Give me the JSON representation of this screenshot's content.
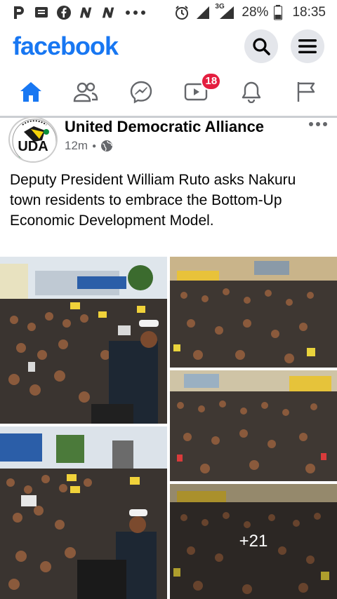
{
  "status_bar": {
    "icons_left": [
      "p-icon",
      "message-icon",
      "facebook-icon",
      "n-icon",
      "n-icon",
      "more-dots-icon"
    ],
    "network": "3G",
    "battery": "28%",
    "time": "18:35"
  },
  "header": {
    "logo": "facebook",
    "search_icon": "search-icon",
    "menu_icon": "menu-icon"
  },
  "tabs": {
    "items": [
      {
        "icon": "home-icon",
        "active": true
      },
      {
        "icon": "friends-icon"
      },
      {
        "icon": "messenger-icon"
      },
      {
        "icon": "video-icon",
        "badge": "18"
      },
      {
        "icon": "notifications-icon"
      },
      {
        "icon": "pages-flag-icon"
      }
    ],
    "accent": "#1877f2"
  },
  "post": {
    "page_name": "United Democratic Alliance",
    "avatar_text": "UDA",
    "time": "12m",
    "privacy_icon": "globe-icon",
    "text": "Deputy President William Ruto asks Nakuru town residents to embrace the Bottom-Up Economic Development Model.",
    "photos": {
      "more_count": "+21"
    }
  }
}
